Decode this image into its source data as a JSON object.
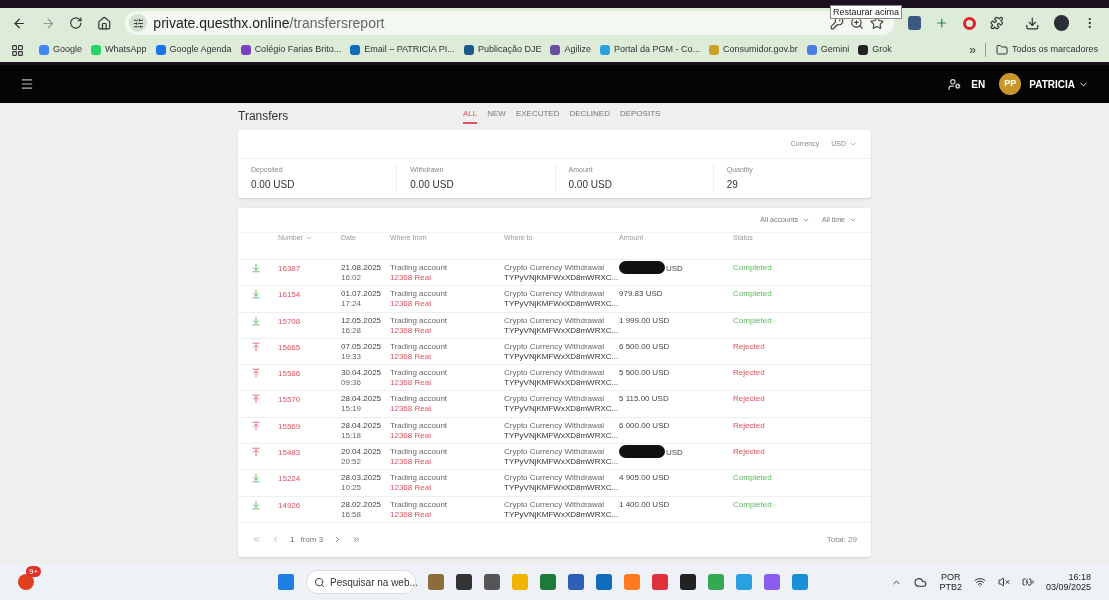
{
  "browser": {
    "url_host": "private.questhx.online",
    "url_path": "/transfersreport",
    "tooltip": "Restaurar acima",
    "bookmarks": [
      {
        "label": "Google",
        "color": "#4285f4"
      },
      {
        "label": "WhatsApp",
        "color": "#25d366"
      },
      {
        "label": "Google Agenda",
        "color": "#1a73e8"
      },
      {
        "label": "Colégio Farias Brito...",
        "color": "#7b3fc4"
      },
      {
        "label": "Email – PATRICIA PI...",
        "color": "#0f6cbd"
      },
      {
        "label": "Publicação DJE",
        "color": "#1d5a8c"
      },
      {
        "label": "Agilize",
        "color": "#6b4fa0"
      },
      {
        "label": "Portal da PGM - Co...",
        "color": "#29a3e0"
      },
      {
        "label": "Consumidor.gov.br",
        "color": "#c9a227"
      },
      {
        "label": "Gemini",
        "color": "#4a7fe8"
      },
      {
        "label": "Grok",
        "color": "#222222"
      }
    ],
    "more": "»",
    "all_bookmarks": "Todos os marcadores"
  },
  "header": {
    "language": "EN",
    "avatar": "PP",
    "user": "PATRICIA"
  },
  "page": {
    "title": "Transfers",
    "tabs": [
      {
        "label": "ALL",
        "selected": true
      },
      {
        "label": "NEW",
        "selected": false
      },
      {
        "label": "EXECUTED",
        "selected": false
      },
      {
        "label": "DECLINED",
        "selected": false
      },
      {
        "label": "DEPOSITS",
        "selected": false
      }
    ],
    "currency_label": "Currency",
    "currency": "USD",
    "summary": [
      {
        "label": "Deposited",
        "value": "0.00 USD"
      },
      {
        "label": "Withdrawn",
        "value": "0.00 USD"
      },
      {
        "label": "Amount",
        "value": "0.00 USD"
      },
      {
        "label": "Quantity",
        "value": "29"
      }
    ],
    "filters": [
      "All accounts",
      "All time"
    ],
    "columns": [
      "Number",
      "Date",
      "Where from",
      "Where to",
      "Amount",
      "Status"
    ],
    "rows": [
      {
        "kind": "completed",
        "number": "16387",
        "date": "21.08.2025",
        "time": "16:02",
        "from": "Trading account",
        "account": "12368 Real",
        "to": "Crypto Currency Withdrawal",
        "address": "TYPyVNjKMFWxXD8mWRXC...",
        "amount": "USD",
        "redacted": true,
        "status": "Completed"
      },
      {
        "kind": "completed",
        "number": "16154",
        "date": "01.07.2025",
        "time": "17:24",
        "from": "Trading account",
        "account": "12368 Real",
        "to": "Crypto Currency Withdrawal",
        "address": "TYPyVNjKMFWxXD8mWRXC...",
        "amount": "979.83 USD",
        "redacted": false,
        "status": "Completed"
      },
      {
        "kind": "completed",
        "number": "15708",
        "date": "12.05.2025",
        "time": "16:28",
        "from": "Trading account",
        "account": "12368 Real",
        "to": "Crypto Currency Withdrawal",
        "address": "TYPyVNjKMFWxXD8mWRXC...",
        "amount": "1 999.00 USD",
        "redacted": false,
        "status": "Completed"
      },
      {
        "kind": "rejected",
        "number": "15665",
        "date": "07.05.2025",
        "time": "19:33",
        "from": "Trading account",
        "account": "12368 Real",
        "to": "Crypto Currency Withdrawal",
        "address": "TYPyVNjKMFWxXD8mWRXC...",
        "amount": "6 500.00 USD",
        "redacted": false,
        "status": "Rejected"
      },
      {
        "kind": "rejected",
        "number": "15586",
        "date": "30.04.2025",
        "time": "09:36",
        "from": "Trading account",
        "account": "12368 Real",
        "to": "Crypto Currency Withdrawal",
        "address": "TYPyVNjKMFWxXD8mWRXC...",
        "amount": "5 500.00 USD",
        "redacted": false,
        "status": "Rejected"
      },
      {
        "kind": "rejected",
        "number": "15570",
        "date": "28.04.2025",
        "time": "15:19",
        "from": "Trading account",
        "account": "12368 Real",
        "to": "Crypto Currency Withdrawal",
        "address": "TYPyVNjKMFWxXD8mWRXC...",
        "amount": "5 115.00 USD",
        "redacted": false,
        "status": "Rejected"
      },
      {
        "kind": "rejected",
        "number": "15569",
        "date": "28.04.2025",
        "time": "15:18",
        "from": "Trading account",
        "account": "12368 Real",
        "to": "Crypto Currency Withdrawal",
        "address": "TYPyVNjKMFWxXD8mWRXC...",
        "amount": "6 000.00 USD",
        "redacted": false,
        "status": "Rejected"
      },
      {
        "kind": "rejected",
        "number": "15483",
        "date": "20.04.2025",
        "time": "20:52",
        "from": "Trading account",
        "account": "12368 Real",
        "to": "Crypto Currency Withdrawal",
        "address": "TYPyVNjKMFWxXD8mWRXC...",
        "amount": "USD",
        "redacted": true,
        "status": "Rejected"
      },
      {
        "kind": "completed",
        "number": "15224",
        "date": "28.03.2025",
        "time": "10:25",
        "from": "Trading account",
        "account": "12368 Real",
        "to": "Crypto Currency Withdrawal",
        "address": "TYPyVNjKMFWxXD8mWRXC...",
        "amount": "4 905.00 USD",
        "redacted": false,
        "status": "Completed"
      },
      {
        "kind": "completed",
        "number": "14926",
        "date": "28.02.2025",
        "time": "16:58",
        "from": "Trading account",
        "account": "12368 Real",
        "to": "Crypto Currency Withdrawal",
        "address": "TYPyVNjKMFWxXD8mWRXC...",
        "amount": "1 400.00 USD",
        "redacted": false,
        "status": "Completed"
      }
    ],
    "pagination": {
      "page": "1",
      "of": "from 3",
      "total": "Total: 29"
    }
  },
  "taskbar": {
    "badge": "9+",
    "search": "Pesquisar na web...",
    "lang": "POR",
    "layout": "PTB2",
    "time": "16:18",
    "date": "03/09/2025"
  }
}
